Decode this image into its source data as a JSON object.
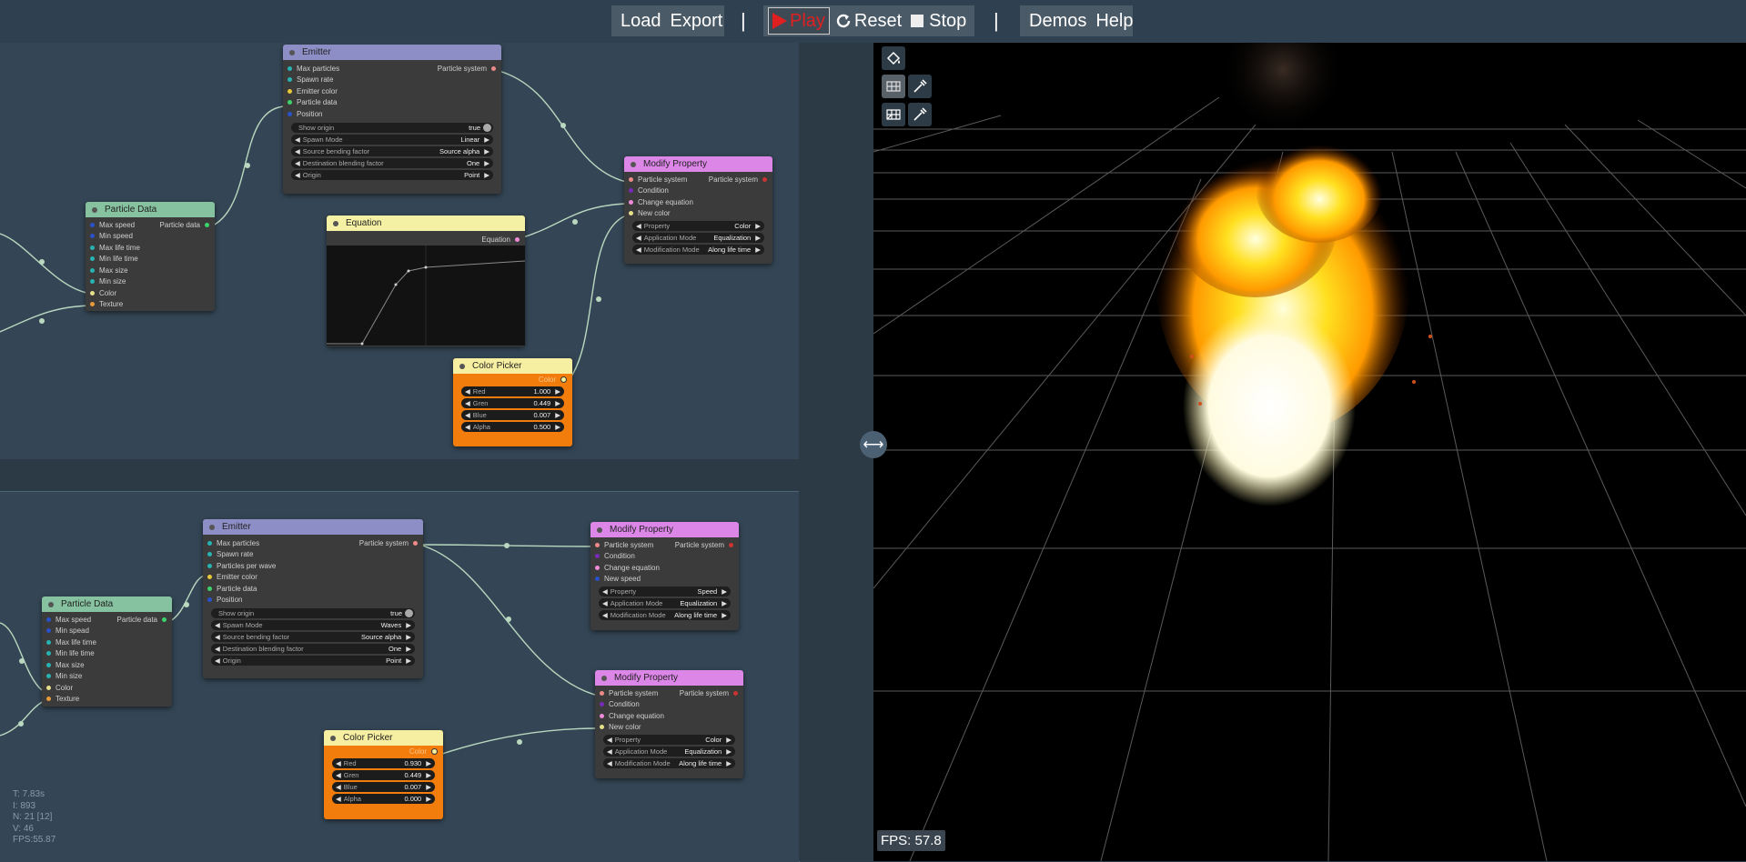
{
  "toolbar": {
    "load": "Load",
    "export": "Export",
    "sep1": "|",
    "play": "Play",
    "reset": "Reset",
    "stop": "Stop",
    "sep2": "|",
    "demos": "Demos",
    "help": "Help"
  },
  "graph1": {
    "emitter": {
      "title": "Emitter",
      "inputs": [
        "Max particles",
        "Spawn rate",
        "Emitter color",
        "Particle data",
        "Position"
      ],
      "output": "Particle system",
      "show_origin": {
        "label": "Show origin",
        "value": "true"
      },
      "selects": [
        {
          "label": "Spawn Mode",
          "value": "Linear"
        },
        {
          "label": "Source bending factor",
          "value": "Source alpha"
        },
        {
          "label": "Destination blending factor",
          "value": "One"
        },
        {
          "label": "Origin",
          "value": "Point"
        }
      ]
    },
    "particle_data": {
      "title": "Particle Data",
      "inputs": [
        "Max speed",
        "Min speed",
        "Max life time",
        "Min life time",
        "Max size",
        "Min size",
        "Color",
        "Texture"
      ],
      "output": "Particle data"
    },
    "equation": {
      "title": "Equation",
      "output": "Equation"
    },
    "modify": {
      "title": "Modify Property",
      "inputs": [
        "Particle system",
        "Condition",
        "Change equation",
        "New color"
      ],
      "output": "Particle system",
      "selects": [
        {
          "label": "Property",
          "value": "Color"
        },
        {
          "label": "Application Mode",
          "value": "Equalization"
        },
        {
          "label": "Modification Mode",
          "value": "Along life time"
        }
      ]
    },
    "color_picker": {
      "title": "Color Picker",
      "output": "Color",
      "fields": [
        {
          "label": "Red",
          "value": "1.000"
        },
        {
          "label": "Gren",
          "value": "0.449"
        },
        {
          "label": "Blue",
          "value": "0.007"
        },
        {
          "label": "Alpha",
          "value": "0.500"
        }
      ]
    }
  },
  "graph2": {
    "emitter": {
      "title": "Emitter",
      "inputs": [
        "Max particles",
        "Spawn rate",
        "Particles per wave",
        "Emitter color",
        "Particle data",
        "Position"
      ],
      "output": "Particle system",
      "show_origin": {
        "label": "Show origin",
        "value": "true"
      },
      "selects": [
        {
          "label": "Spawn Mode",
          "value": "Waves"
        },
        {
          "label": "Source bending factor",
          "value": "Source alpha"
        },
        {
          "label": "Destination blending factor",
          "value": "One"
        },
        {
          "label": "Origin",
          "value": "Point"
        }
      ]
    },
    "particle_data": {
      "title": "Particle Data",
      "inputs": [
        "Max speed",
        "Min spead",
        "Max life time",
        "Min life time",
        "Max size",
        "Min size",
        "Color",
        "Texture"
      ],
      "output": "Particle data"
    },
    "modify1": {
      "title": "Modify Property",
      "inputs": [
        "Particle system",
        "Condition",
        "Change equation",
        "New speed"
      ],
      "output": "Particle system",
      "selects": [
        {
          "label": "Property",
          "value": "Speed"
        },
        {
          "label": "Application Mode",
          "value": "Equalization"
        },
        {
          "label": "Modification Mode",
          "value": "Along life time"
        }
      ]
    },
    "modify2": {
      "title": "Modify Property",
      "inputs": [
        "Particle system",
        "Condition",
        "Change equation",
        "New color"
      ],
      "output": "Particle system",
      "selects": [
        {
          "label": "Property",
          "value": "Color"
        },
        {
          "label": "Application Mode",
          "value": "Equalization"
        },
        {
          "label": "Modification Mode",
          "value": "Along life time"
        }
      ]
    },
    "color_picker": {
      "title": "Color Picker",
      "output": "Color",
      "fields": [
        {
          "label": "Red",
          "value": "0.930"
        },
        {
          "label": "Gren",
          "value": "0.449"
        },
        {
          "label": "Blue",
          "value": "0.007"
        },
        {
          "label": "Alpha",
          "value": "0.000"
        }
      ]
    }
  },
  "stats": [
    "T: 7.83s",
    "I: 893",
    "N: 21 [12]",
    "V: 46",
    "FPS:55.87"
  ],
  "viewport": {
    "fps": "FPS: 57.8"
  },
  "colors": {
    "play": "#e02020",
    "accent_orange": "#f27c0c",
    "emitter_header": "#8e8ec6",
    "modify_header": "#dc86e8",
    "particle_header": "#86c1a0"
  }
}
